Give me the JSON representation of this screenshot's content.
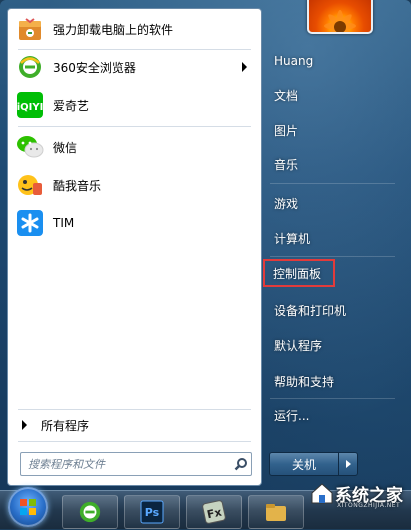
{
  "programs": [
    {
      "label": "强力卸载电脑上的软件",
      "icon": "uninstaller-box-icon"
    },
    {
      "label": "360安全浏览器",
      "icon": "360-browser-icon",
      "has_submenu": true
    },
    {
      "label": "爱奇艺",
      "icon": "iqiyi-icon"
    },
    {
      "label": "微信",
      "icon": "wechat-icon"
    },
    {
      "label": "酷我音乐",
      "icon": "kuwo-music-icon"
    },
    {
      "label": "TIM",
      "icon": "tim-icon"
    }
  ],
  "all_programs_label": "所有程序",
  "search": {
    "placeholder": "搜索程序和文件"
  },
  "right_items": [
    {
      "label": "Huang"
    },
    {
      "label": "文档"
    },
    {
      "label": "图片"
    },
    {
      "label": "音乐"
    },
    {
      "label": "游戏"
    },
    {
      "label": "计算机"
    },
    {
      "label": "控制面板",
      "highlighted": true
    },
    {
      "label": "设备和打印机"
    },
    {
      "label": "默认程序"
    },
    {
      "label": "帮助和支持"
    },
    {
      "label": "运行..."
    }
  ],
  "shutdown": {
    "label": "关机"
  },
  "taskbar": {
    "items": [
      "360-browser-icon",
      "photoshop-icon",
      "fx-app-icon"
    ],
    "photoshop_label": "Ps"
  },
  "watermark": {
    "text": "系统之家",
    "sub": "XITONGZHIJIA.NET"
  },
  "colors": {
    "highlight": "#e23b3b",
    "menu_bg": "#1e4a73"
  }
}
